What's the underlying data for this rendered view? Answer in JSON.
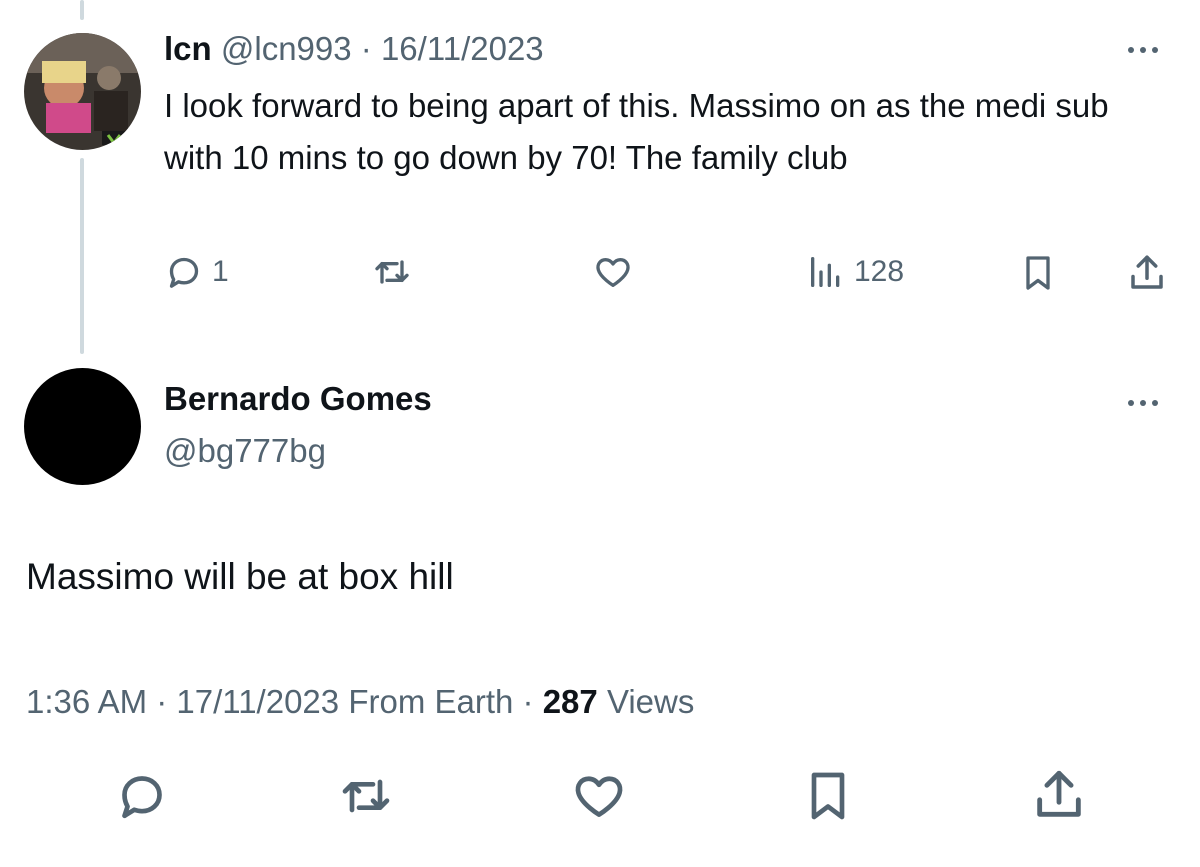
{
  "reply_tweet": {
    "display_name": "lcn",
    "handle": "@lcn993",
    "separator": "·",
    "date": "16/11/2023",
    "text": "I look forward to being apart of this. Massimo on as the medi sub with 10 mins to go down by 70! The family club",
    "reply_count": "1",
    "views_count": "128"
  },
  "main_tweet": {
    "display_name": "Bernardo Gomes",
    "handle": "@bg777bg",
    "text": "Massimo will be at box hill",
    "time": "1:36 AM",
    "separator": "·",
    "date": "17/11/2023",
    "source": "From Earth",
    "separator2": "·",
    "views_count": "287",
    "views_label": "Views"
  },
  "colors": {
    "text": "#0f1419",
    "muted": "#536471",
    "thread_line": "#cfd9de"
  }
}
